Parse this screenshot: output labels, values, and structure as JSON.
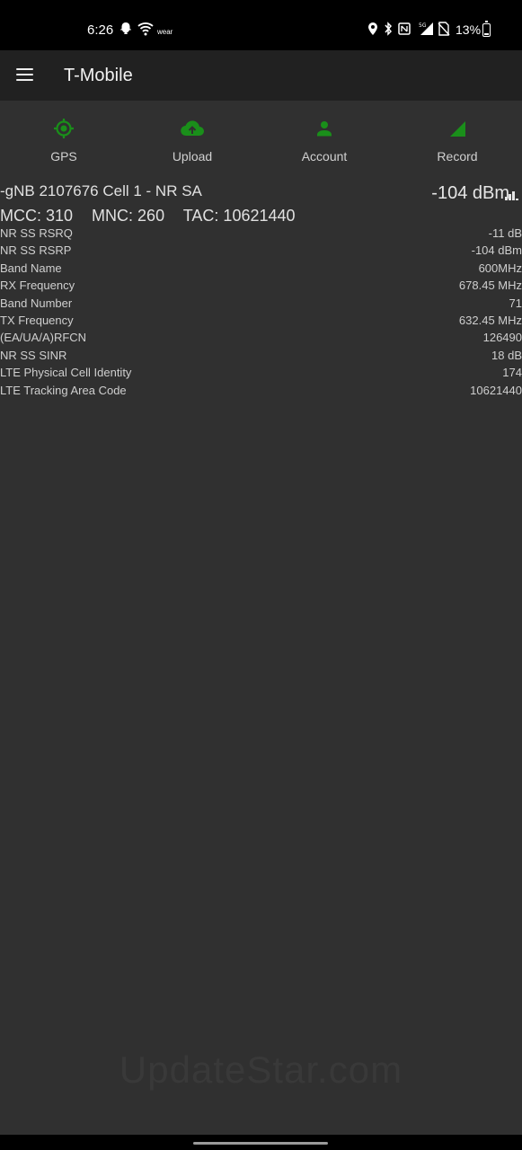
{
  "status_bar": {
    "time": "6:26",
    "wear_label": "wear",
    "battery_percent": "13%",
    "icons": [
      "snapchat-ghost-icon",
      "wifi-icon",
      "location-icon",
      "bluetooth-icon",
      "nfc-icon",
      "5g-signal-icon",
      "no-sim-icon",
      "battery-icon"
    ]
  },
  "app_bar": {
    "title": "T-Mobile",
    "menu_icon": "hamburger-menu-icon"
  },
  "toolbar": {
    "accent_color": "#1a8f1a",
    "items": [
      {
        "label": "GPS",
        "icon": "gps-crosshair-icon"
      },
      {
        "label": "Upload",
        "icon": "cloud-upload-icon"
      },
      {
        "label": "Account",
        "icon": "person-icon"
      },
      {
        "label": "Record",
        "icon": "signal-triangle-icon"
      }
    ]
  },
  "cell": {
    "header": "-gNB 2107676 Cell 1 - NR SA",
    "signal_strength": "-104 dBm",
    "signal_icon": "signal-bars-icon",
    "mcc": "MCC: 310",
    "mnc": "MNC: 260",
    "tac": "TAC: 10621440"
  },
  "details": [
    {
      "label": "NR SS RSRQ",
      "value": "-11 dB"
    },
    {
      "label": "NR SS RSRP",
      "value": "-104 dBm"
    },
    {
      "label": "Band Name",
      "value": "600MHz"
    },
    {
      "label": "RX Frequency",
      "value": "678.45 MHz"
    },
    {
      "label": "Band Number",
      "value": "71"
    },
    {
      "label": "TX Frequency",
      "value": "632.45 MHz"
    },
    {
      "label": "(EA/UA/A)RFCN",
      "value": "126490"
    },
    {
      "label": "NR SS SINR",
      "value": "18 dB"
    },
    {
      "label": "LTE Physical Cell Identity",
      "value": "174"
    },
    {
      "label": "LTE Tracking Area Code",
      "value": "10621440"
    }
  ],
  "watermark": "UpdateStar.com"
}
